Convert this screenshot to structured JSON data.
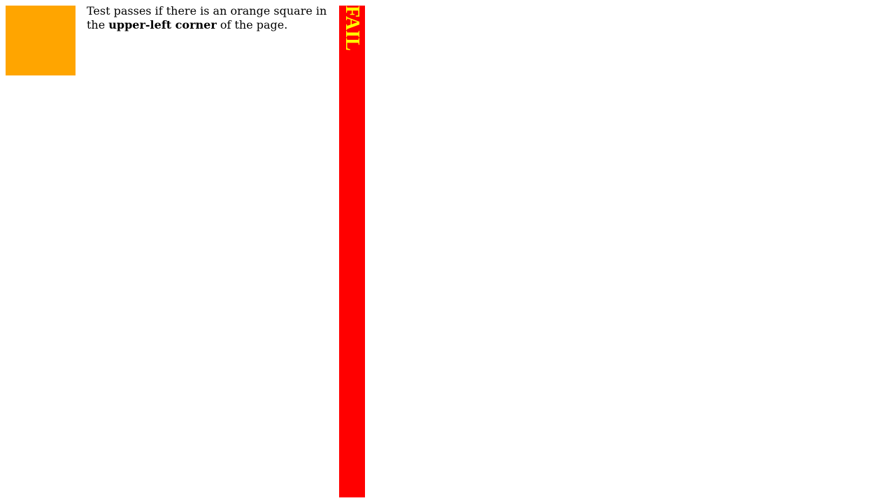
{
  "instructions": {
    "prefix": "Test passes if there is an orange square in the ",
    "emphasis": "upper-left corner",
    "suffix": " of the page."
  },
  "fail_label": "FAIL",
  "colors": {
    "square": "#FFA500",
    "fail_background": "#FF0000",
    "fail_text": "#FFFF00"
  }
}
